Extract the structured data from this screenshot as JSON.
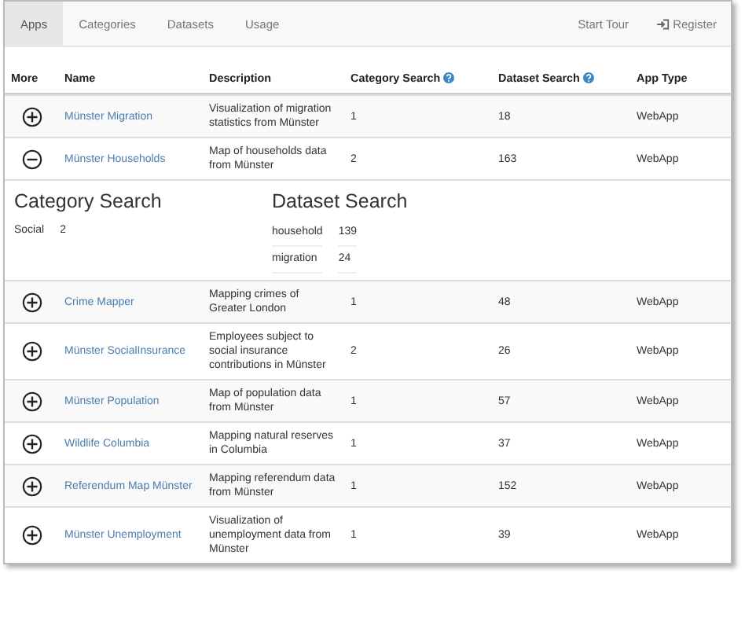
{
  "nav": {
    "tabs": [
      {
        "label": "Apps",
        "selected": true
      },
      {
        "label": "Categories",
        "selected": false
      },
      {
        "label": "Datasets",
        "selected": false
      },
      {
        "label": "Usage",
        "selected": false
      }
    ],
    "links": [
      "Start Tour",
      "Register"
    ]
  },
  "table": {
    "columns": [
      "More",
      "Name",
      "Description",
      "Category Search",
      "Dataset Search",
      "App Type"
    ],
    "rows": [
      {
        "expanded": false,
        "name": "Münster Migration",
        "description": "Visualization of migration statistics from Münster",
        "category_search": "1",
        "dataset_search": "18",
        "app_type": "WebApp"
      },
      {
        "expanded": true,
        "name": "Münster Households",
        "description": "Map of households data from Münster",
        "category_search": "2",
        "dataset_search": "163",
        "app_type": "WebApp",
        "details": {
          "category_title": "Category Search",
          "categories": [
            {
              "term": "Social",
              "count": "2"
            }
          ],
          "dataset_title": "Dataset Search",
          "datasets": [
            {
              "term": "household",
              "count": "139"
            },
            {
              "term": "migration",
              "count": "24"
            }
          ]
        }
      },
      {
        "expanded": false,
        "name": "Crime Mapper",
        "description": "Mapping crimes of Greater London",
        "category_search": "1",
        "dataset_search": "48",
        "app_type": "WebApp"
      },
      {
        "expanded": false,
        "name": "Münster SocialInsurance",
        "description": "Employees subject to social insurance contributions in Münster",
        "category_search": "2",
        "dataset_search": "26",
        "app_type": "WebApp"
      },
      {
        "expanded": false,
        "name": "Münster Population",
        "description": "Map of population data from Münster",
        "category_search": "1",
        "dataset_search": "57",
        "app_type": "WebApp"
      },
      {
        "expanded": false,
        "name": "Wildlife Columbia",
        "description": "Mapping natural reserves in Columbia",
        "category_search": "1",
        "dataset_search": "37",
        "app_type": "WebApp"
      },
      {
        "expanded": false,
        "name": "Referendum Map Münster",
        "description": "Mapping referendum data from Münster",
        "category_search": "1",
        "dataset_search": "152",
        "app_type": "WebApp"
      },
      {
        "expanded": false,
        "name": "Münster Unemployment",
        "description": "Visualization of unemployment data from Münster",
        "category_search": "1",
        "dataset_search": "39",
        "app_type": "WebApp"
      }
    ]
  }
}
